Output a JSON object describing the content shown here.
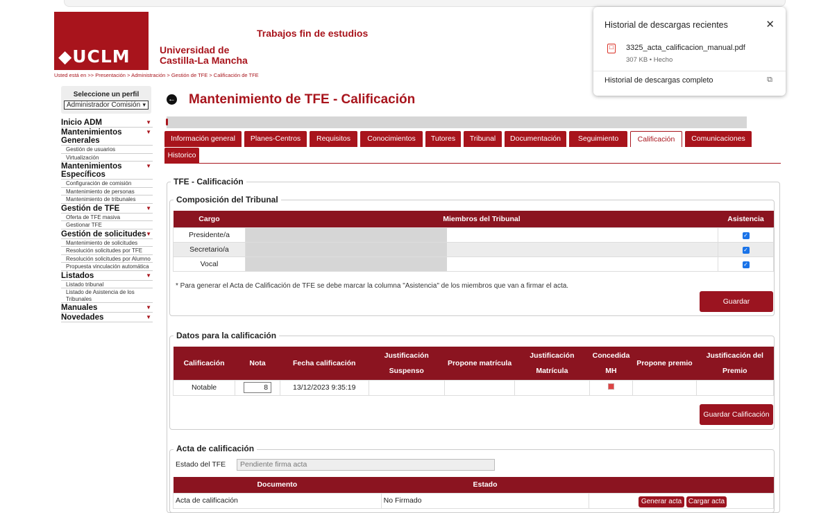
{
  "header": {
    "logo_text": "◆UCLM",
    "university_line1": "Universidad de",
    "university_line2": "Castilla-La Mancha",
    "app_title": "Trabajos fin de estudios",
    "breadcrumb": "Usted está en >> Presentación > Administración > Gestión de TFE > Calificación de TFE"
  },
  "profile": {
    "label": "Seleccione un perfil",
    "selected": "Administrador Comisión"
  },
  "sidebar": [
    {
      "title": "Inicio ADM",
      "items": []
    },
    {
      "title": "Mantenimientos Generales",
      "items": [
        "Gestión de usuarios",
        "Virtualización"
      ]
    },
    {
      "title": "Mantenimientos Específicos",
      "items": [
        "Configuración de comisión",
        "Mantenimiento de personas",
        "Mantenimiento de tribunales"
      ]
    },
    {
      "title": "Gestión de TFE",
      "items": [
        "Oferta de TFE masiva",
        "Gestionar TFE"
      ]
    },
    {
      "title": "Gestión de solicitudes",
      "items": [
        "Mantenimiento de solicitudes",
        "Resolución solicitudes por TFE",
        "Resolución solicitudes por Alumno",
        "Propuesta vinculación automática"
      ]
    },
    {
      "title": "Listados",
      "items": [
        "Listado tribunal",
        "Listado de Asistencia de los Tribunales"
      ]
    },
    {
      "title": "Manuales",
      "items": []
    },
    {
      "title": "Novedades",
      "items": []
    }
  ],
  "page": {
    "title": "Mantenimiento de TFE - Calificación"
  },
  "tabs": [
    "Información general",
    "Planes-Centros",
    "Requisitos",
    "Conocimientos",
    "Tutores",
    "Tribunal",
    "Documentación",
    "Seguimiento",
    "Calificación",
    "Comunicaciones",
    "Historico"
  ],
  "active_tab": "Calificación",
  "calificacion": {
    "legend": "TFE - Calificación",
    "tribunal": {
      "legend": "Composición del Tribunal",
      "headers": [
        "Cargo",
        "Miembros del Tribunal",
        "Asistencia"
      ],
      "rows": [
        {
          "cargo": "Presidente/a",
          "asistencia": true
        },
        {
          "cargo": "Secretario/a",
          "asistencia": true
        },
        {
          "cargo": "Vocal",
          "asistencia": true
        }
      ],
      "note": "* Para generar el Acta de Calificación de TFE se debe marcar la columna \"Asistencia\" de los miembros que van a firmar el acta.",
      "save_button": "Guardar"
    },
    "datos": {
      "legend": "Datos para la calificación",
      "headers": [
        "Calificación",
        "Nota",
        "Fecha calificación",
        "Justificación Suspenso",
        "Propone matrícula",
        "Justificación Matrícula",
        "Concedida MH",
        "Propone premio",
        "Justificación del Premio"
      ],
      "row": {
        "calificacion": "Notable",
        "nota": "8",
        "fecha": "13/12/2023 9:35:19"
      },
      "save_button": "Guardar Calificación"
    },
    "acta": {
      "legend": "Acta de calificación",
      "estado_label": "Estado del TFE",
      "estado_value": "Pendiente firma acta",
      "headers": [
        "Documento",
        "Estado"
      ],
      "row": {
        "documento": "Acta de calificación",
        "estado": "No Firmado"
      },
      "generate_button": "Generar acta",
      "upload_button": "Cargar acta"
    }
  },
  "downloads": {
    "title": "Historial de descargas recientes",
    "file_name": "3325_acta_calificacion_manual.pdf",
    "file_meta": "307 KB • Hecho",
    "full_history": "Historial de descargas completo"
  },
  "colors": {
    "brand": "#a8141c",
    "header_row": "#8b1420"
  }
}
